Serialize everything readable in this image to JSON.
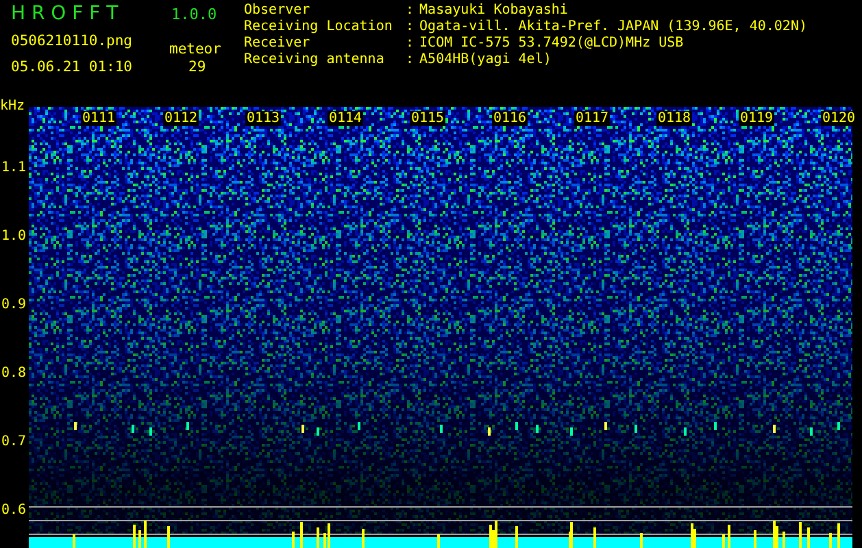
{
  "app": {
    "name": "H R O F F T",
    "version": "1.0.0"
  },
  "file": {
    "name": "0506210110.png",
    "datetime": "05.06.21 01:10"
  },
  "meteor": {
    "label": "meteor",
    "count": "29"
  },
  "info": [
    {
      "label": "Observer",
      "separator": ":",
      "value": "Masayuki Kobayashi"
    },
    {
      "label": "Receiving Location",
      "separator": ":",
      "value": "Ogata-vill. Akita-Pref. JAPAN (139.96E, 40.02N)"
    },
    {
      "label": "Receiver",
      "separator": ":",
      "value": "ICOM IC-575 53.7492(@LCD)MHz USB"
    },
    {
      "label": "Receiving antenna",
      "separator": ":",
      "value": "A504HB(yagi 4el)"
    }
  ],
  "spectrogram": {
    "frequency_unit": "kHz",
    "frequency_labels": [
      "1.1",
      "1.0",
      "0.9",
      "0.8",
      "0.7",
      "0.6"
    ],
    "time_labels": [
      "0111",
      "0112",
      "0113",
      "0114",
      "0115",
      "0116",
      "0117",
      "0118",
      "0119",
      "0120"
    ]
  }
}
